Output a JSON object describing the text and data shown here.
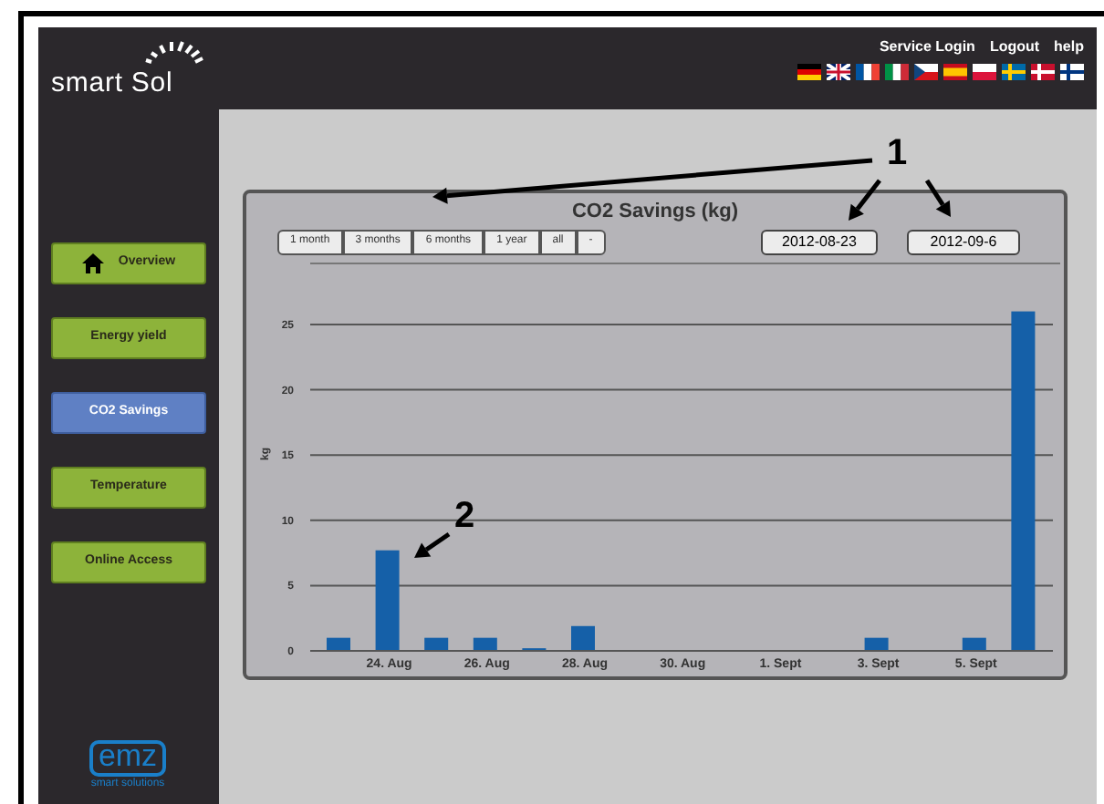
{
  "header": {
    "logo": "smart Sol",
    "links": [
      "Service Login",
      "Logout",
      "help"
    ]
  },
  "sidebar": {
    "items": [
      {
        "label": "Overview",
        "kind": "home",
        "selected": false
      },
      {
        "label": "Energy yield",
        "kind": "plain",
        "selected": false
      },
      {
        "label": "CO2 Savings",
        "kind": "plain",
        "selected": true
      },
      {
        "label": "Temperature",
        "kind": "plain",
        "selected": false
      },
      {
        "label": "Online Access",
        "kind": "plain",
        "selected": false
      }
    ],
    "footer_logo": {
      "mark": "emz",
      "tagline": "smart solutions"
    }
  },
  "chart_panel": {
    "title": "CO2 Savings (kg)",
    "ranges": [
      "1 month",
      "3 months",
      "6 months",
      "1 year",
      "all",
      "-"
    ],
    "date_from": "2012-08-23",
    "date_to": "2012-09-6",
    "chart_data": {
      "type": "bar",
      "ylabel": "kg",
      "categories": [
        null,
        "24. Aug",
        null,
        "26. Aug",
        null,
        "28. Aug",
        null,
        "30. Aug",
        null,
        "1. Sept",
        null,
        "3. Sept",
        null,
        "5. Sept",
        null
      ],
      "values": [
        1,
        7.7,
        1,
        1,
        0.2,
        1.9,
        0,
        0,
        0,
        0,
        0,
        1,
        0,
        1,
        26
      ],
      "ylim": [
        0,
        26
      ],
      "yticks": [
        0,
        5,
        10,
        15,
        20,
        25
      ],
      "grid": true
    }
  },
  "annotations": [
    {
      "label": "1"
    },
    {
      "label": "2"
    }
  ]
}
